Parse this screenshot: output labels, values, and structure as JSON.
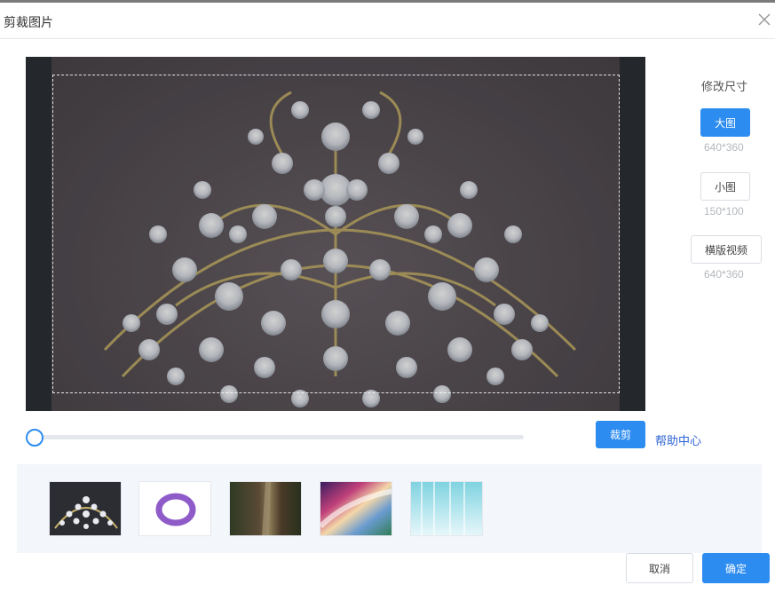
{
  "dialog": {
    "title": "剪裁图片",
    "close_icon": "close-icon"
  },
  "size_panel": {
    "title": "修改尺寸",
    "options": [
      {
        "label": "大图",
        "dims": "640*360",
        "selected": true
      },
      {
        "label": "小图",
        "dims": "150*100",
        "selected": false
      },
      {
        "label": "横版视频",
        "dims": "640*360",
        "selected": false
      }
    ]
  },
  "zoom": {
    "value": 0.0
  },
  "actions": {
    "crop_label": "裁剪",
    "help_label": "帮助中心",
    "cancel_label": "取消",
    "confirm_label": "确定"
  },
  "thumbnails": [
    {
      "name": "tiara-thumbnail"
    },
    {
      "name": "purple-ring-thumbnail"
    },
    {
      "name": "canyon-thumbnail"
    },
    {
      "name": "color-swirl-thumbnail"
    },
    {
      "name": "light-rays-thumbnail"
    }
  ],
  "colors": {
    "primary": "#2d8cf0",
    "link": "#2d63d6",
    "stage_bg": "#2d3035"
  }
}
